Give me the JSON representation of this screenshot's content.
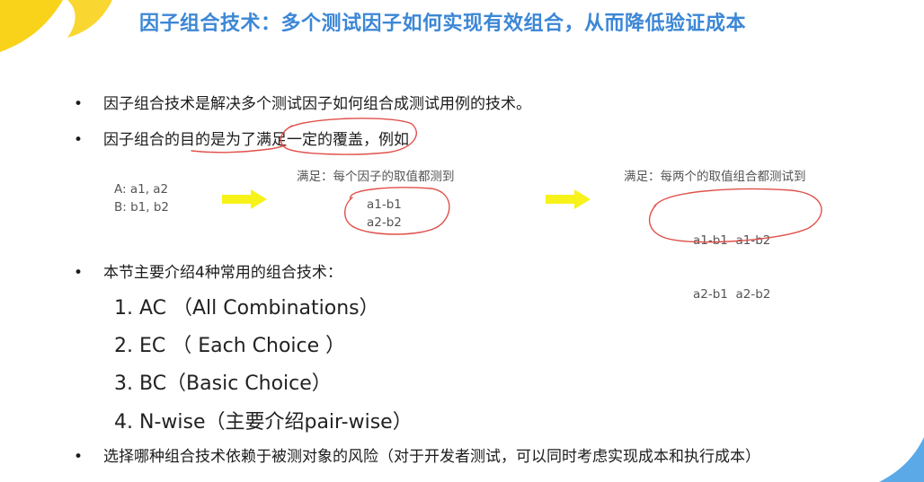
{
  "title": "因子组合技术：多个测试因子如何实现有效组合，从而降低验证成本",
  "bullet_glyph": "•",
  "bullets": [
    "因子组合技术是解决多个测试因子如何组合成测试用例的技术。",
    "因子组合的目的是为了满足一定的覆盖，例如",
    "本节主要介绍4种常用的组合技术：",
    "选择哪种组合技术依赖于被测对象的风险（对于开发者测试，可以同时考虑实现成本和执行成本）"
  ],
  "example": {
    "factors": [
      "A: a1, a2",
      "B: b1, b2"
    ],
    "each_choice": {
      "label": "满足：每个因子的取值都测到",
      "rows": [
        "a1-b1",
        "a2-b2"
      ]
    },
    "pairwise": {
      "label": "满足：每两个的取值组合都测试到",
      "rows": [
        "a1-b1  a1-b2",
        "a2-b1  a2-b2"
      ]
    }
  },
  "techniques": [
    "1.  AC （All Combinations）",
    "2.  EC （ Each Choice ）",
    "3.  BC（Basic Choice）",
    "4.  N-wise（主要介绍pair-wise）"
  ],
  "colors": {
    "title": "#3c87d6",
    "arrow": "#f7f21a",
    "annotation": "#e0504a",
    "corner": "#f9d21a"
  },
  "icons": {
    "arrow": "arrow-right-icon"
  }
}
